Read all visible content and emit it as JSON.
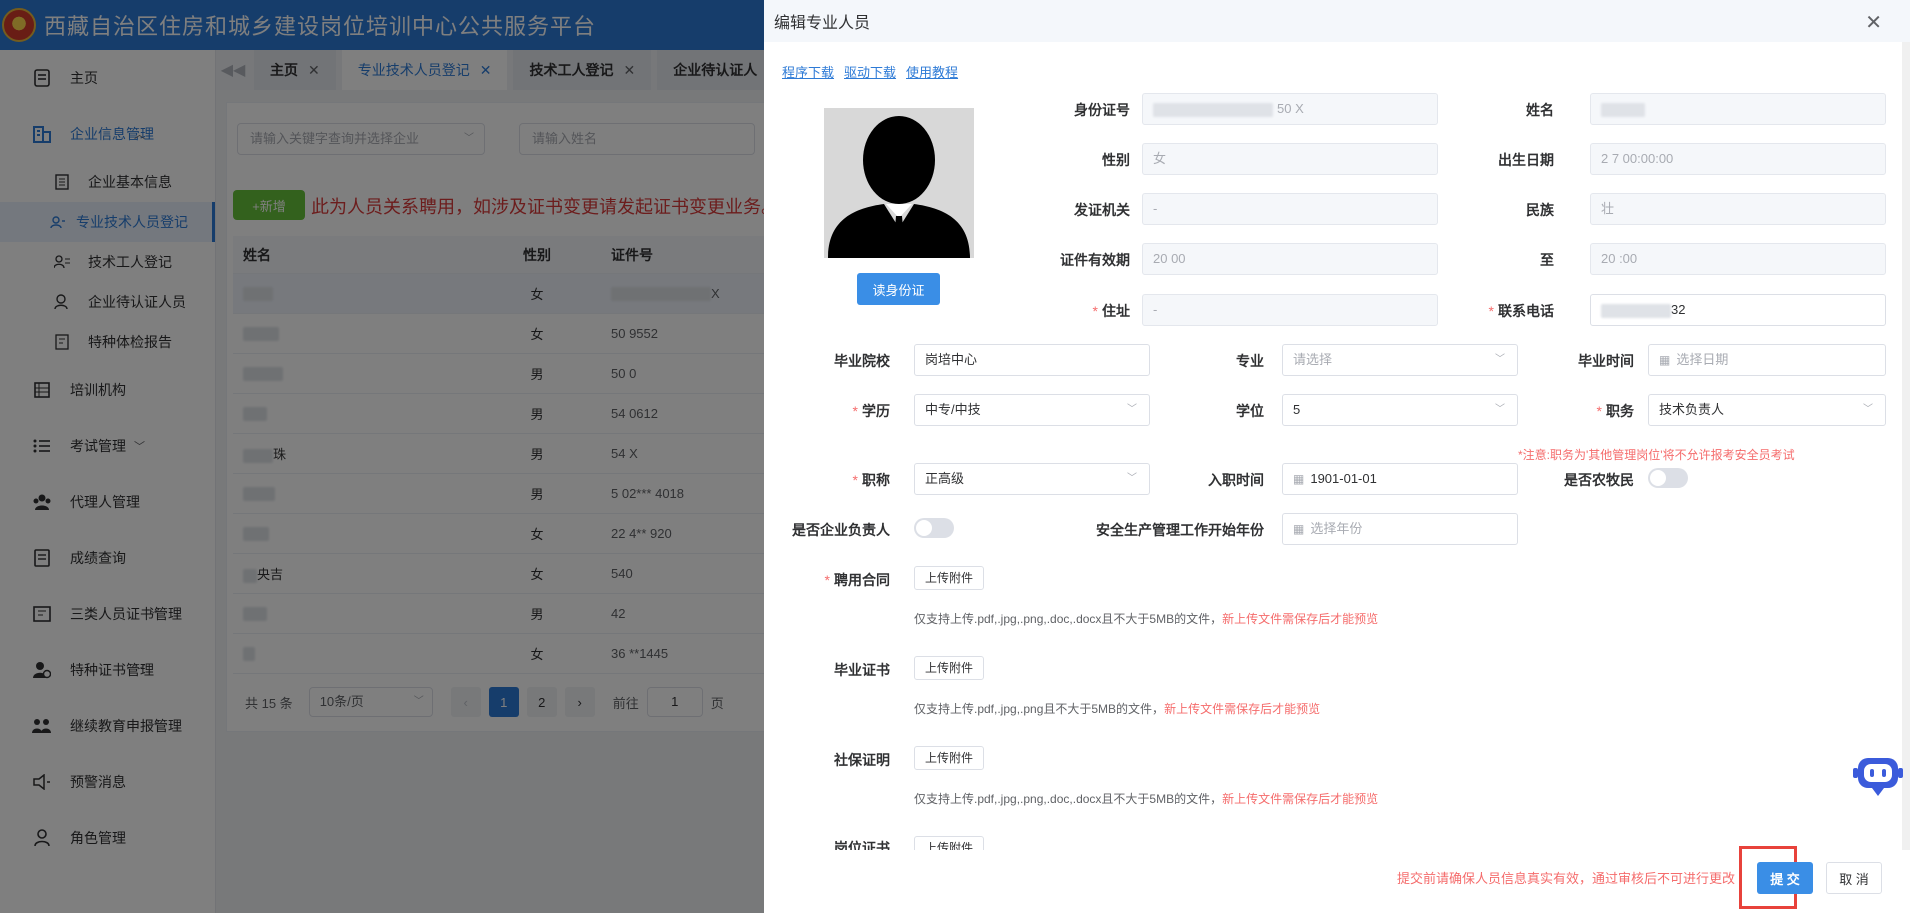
{
  "app": {
    "title": "西藏自治区住房和城乡建设岗位培训中心公共服务平台"
  },
  "sidebar": {
    "items": [
      {
        "label": "主页",
        "icon": "home-doc-icon"
      },
      {
        "label": "企业信息管理",
        "icon": "building-icon",
        "expanded": true
      },
      {
        "label": "企业基本信息",
        "icon": "doc-icon",
        "sub": true
      },
      {
        "label": "专业技术人员登记",
        "icon": "user-card-icon",
        "sub": true,
        "active": true
      },
      {
        "label": "技术工人登记",
        "icon": "user-list-icon",
        "sub": true
      },
      {
        "label": "企业待认证人员",
        "icon": "user-pending-icon",
        "sub": true
      },
      {
        "label": "特种体检报告",
        "icon": "report-icon",
        "sub": true
      },
      {
        "label": "培训机构",
        "icon": "institution-icon"
      },
      {
        "label": "考试管理",
        "icon": "list-icon",
        "collapsible": true
      },
      {
        "label": "代理人管理",
        "icon": "team-icon"
      },
      {
        "label": "成绩查询",
        "icon": "score-icon"
      },
      {
        "label": "三类人员证书管理",
        "icon": "cert-icon",
        "collapsible": true
      },
      {
        "label": "特种证书管理",
        "icon": "special-cert-icon",
        "collapsible": true
      },
      {
        "label": "继续教育申报管理",
        "icon": "education-icon",
        "collapsible": true
      },
      {
        "label": "预警消息",
        "icon": "alert-icon"
      },
      {
        "label": "角色管理",
        "icon": "role-icon"
      }
    ]
  },
  "tabs": [
    {
      "label": "主页",
      "active": false
    },
    {
      "label": "专业技术人员登记",
      "active": true
    },
    {
      "label": "技术工人登记",
      "active": false
    },
    {
      "label": "企业待认证人"
    }
  ],
  "main": {
    "enterprise_placeholder": "请输入关键字查询并选择企业",
    "name_placeholder": "请输入姓名",
    "add_label": "+新增",
    "notice": "此为人员关系聘用，如涉及证书变更请发起证书变更业务。",
    "columns": [
      "姓名",
      "性别",
      "证件号"
    ],
    "rows": [
      {
        "name": "",
        "gender": "女",
        "id": "X"
      },
      {
        "name": "",
        "gender": "女",
        "id": "50 9552"
      },
      {
        "name": "",
        "gender": "男",
        "id": "50 0"
      },
      {
        "name": "",
        "gender": "男",
        "id": "54 0612"
      },
      {
        "name": "珠",
        "gender": "男",
        "id": "54 X"
      },
      {
        "name": "",
        "gender": "男",
        "id": "5 02*** 4018"
      },
      {
        "name": "",
        "gender": "女",
        "id": "22 4** 920"
      },
      {
        "name": "央吉",
        "gender": "女",
        "id": "540"
      },
      {
        "name": "",
        "gender": "男",
        "id": "42"
      },
      {
        "name": "",
        "gender": "女",
        "id": "36 **1445"
      }
    ],
    "pager": {
      "total": "共 15 条",
      "size": "10条/页",
      "pages": [
        "1",
        "2"
      ],
      "current": "1",
      "goto_label": "前往",
      "goto_value": "1",
      "page_unit": "页"
    }
  },
  "dialog": {
    "title": "编辑专业人员",
    "links": [
      "程序下载",
      "驱动下载",
      "使用教程"
    ],
    "read_id_label": "读身份证",
    "labels": {
      "id_number": "身份证号",
      "name": "姓名",
      "gender": "性别",
      "birth": "出生日期",
      "issuer": "发证机关",
      "ethnic": "民族",
      "valid_from": "证件有效期",
      "valid_to": "至",
      "address": "住址",
      "phone": "联系电话",
      "school": "毕业院校",
      "major": "专业",
      "grad_time": "毕业时间",
      "education": "学历",
      "degree": "学位",
      "position": "职务",
      "title_rank": "职称",
      "hire_date": "入职时间",
      "farmer": "是否农牧民",
      "is_leader": "是否企业负责人",
      "safety_year": "安全生产管理工作开始年份",
      "contract": "聘用合同",
      "diploma": "毕业证书",
      "social": "社保证明",
      "post_cert": "岗位证书"
    },
    "values": {
      "id_number": "50 X",
      "name": "",
      "gender": "女",
      "birth": "2 7 00:00:00",
      "issuer": "-",
      "ethnic": "壮",
      "valid_from": "20 00",
      "valid_to": "20 :00",
      "address": "-",
      "phone": "32",
      "school": "岗培中心",
      "major_placeholder": "请选择",
      "grad_placeholder": "选择日期",
      "education": "中专/中技",
      "degree": "5",
      "position": "技术负责人",
      "title_rank": "正高级",
      "hire_date": "1901-01-01",
      "year_placeholder": "选择年份"
    },
    "position_warning": "*注意:职务为'其他管理岗位'将不允许报考安全员考试",
    "upload_label": "上传附件",
    "hint_docs": "仅支持上传.pdf,.jpg,.png,.doc,.docx且不大于5MB的文件，",
    "hint_imgs": "仅支持上传.pdf,.jpg,.png且不大于5MB的文件，",
    "hint_red": "新上传文件需保存后才能预览",
    "footer_note": "提交前请确保人员信息真实有效，通过审核后不可进行更改",
    "submit_label": "提 交",
    "cancel_label": "取 消"
  },
  "colors": {
    "primary": "#2d7ad6",
    "danger": "#f56c6c",
    "success": "#67c23a",
    "highlight_box": "#e8423b"
  }
}
